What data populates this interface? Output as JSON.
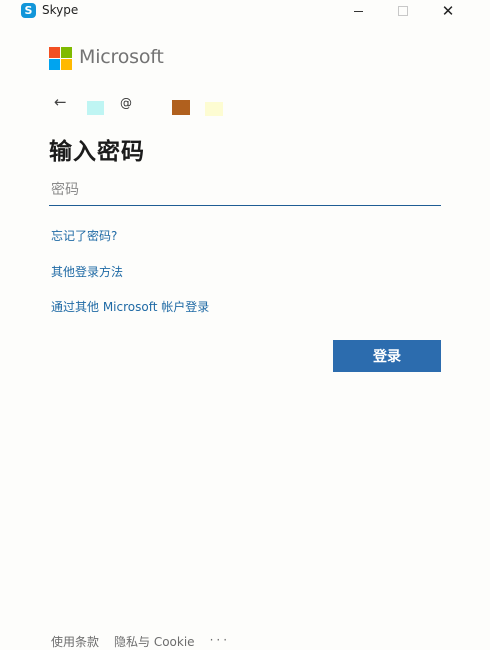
{
  "window": {
    "title": "Skype",
    "app_icon": "skype-icon",
    "controls": [
      "minimize",
      "maximize",
      "close"
    ]
  },
  "brand": {
    "name": "Microsoft",
    "colors": [
      "#f25022",
      "#7fba00",
      "#00a4ef",
      "#ffb900"
    ]
  },
  "account": {
    "at_sign": "@"
  },
  "form": {
    "heading": "输入密码",
    "password_placeholder": "密码",
    "password_value": ""
  },
  "links": {
    "forgot_password": "忘记了密码?",
    "other_signin": "其他登录方法",
    "other_account": "通过其他 Microsoft 帐户登录"
  },
  "buttons": {
    "signin": "登录",
    "signin_color": "#2c6cae"
  },
  "footer": {
    "terms": "使用条款",
    "privacy": "隐私与 Cookie",
    "more": "···"
  }
}
